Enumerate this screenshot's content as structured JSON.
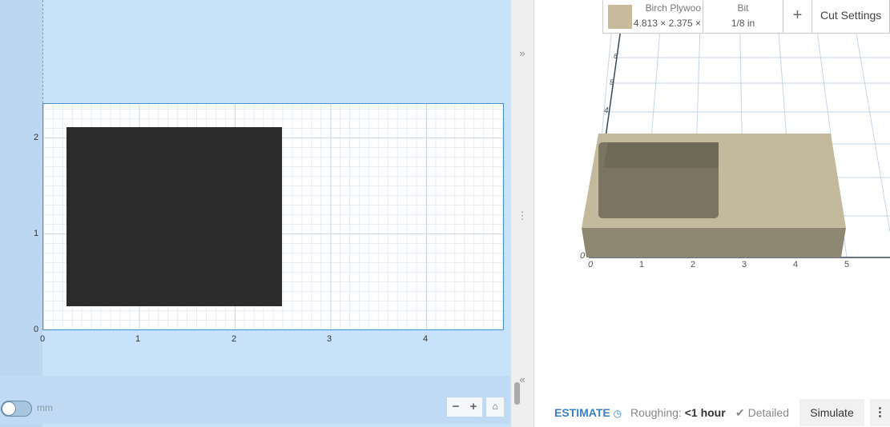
{
  "canvas2d": {
    "y_ticks": [
      "0",
      "1",
      "2"
    ],
    "x_ticks": [
      "0",
      "1",
      "2",
      "3",
      "4"
    ],
    "unit_toggle_label": "mm",
    "zoom_out": "−",
    "zoom_in": "+",
    "home_icon": "home-icon"
  },
  "divider": {
    "expand": "»",
    "handle": "⋮",
    "collapse": "«"
  },
  "material": {
    "name": "Birch Plywoo",
    "dims": "4.813 × 2.375 ×",
    "swatch_color": "#c8bb9c"
  },
  "bit": {
    "label": "Bit",
    "value": "1/8 in"
  },
  "add": "+",
  "cut_settings": "Cut Settings",
  "view3d": {
    "x_ticks": [
      "0",
      "1",
      "2",
      "3",
      "4",
      "5"
    ],
    "y_ticks": [
      "0",
      "4",
      "5",
      "6"
    ]
  },
  "footer": {
    "estimate": "ESTIMATE",
    "roughing_label": "Roughing:",
    "roughing_value": "<1 hour",
    "detailed": "Detailed",
    "simulate": "Simulate",
    "more": "⋮"
  }
}
